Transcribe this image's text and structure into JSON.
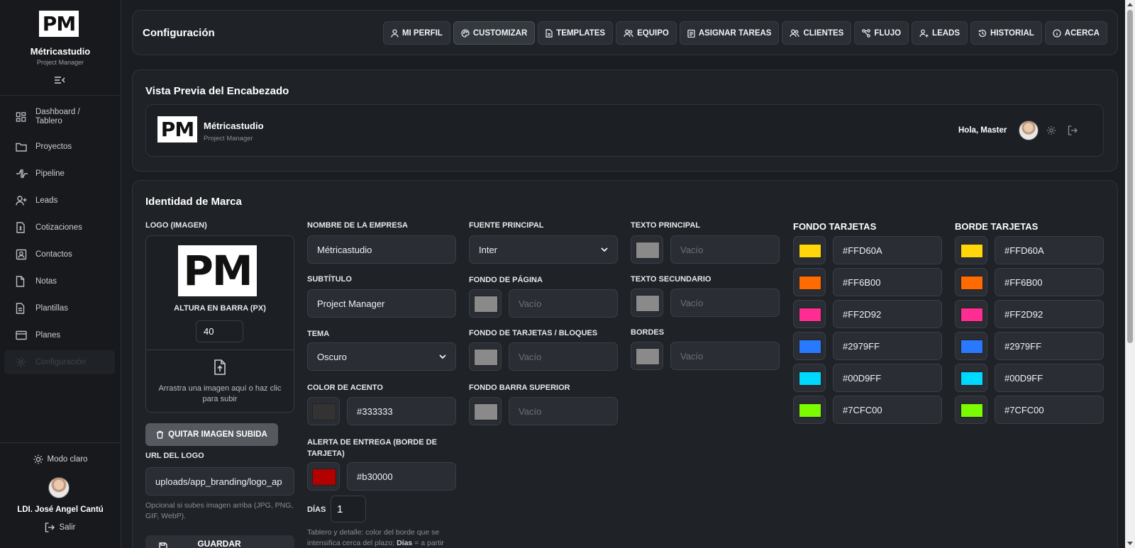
{
  "sidebar": {
    "logo_text": "PM",
    "brand_name": "Métricastudio",
    "brand_sub": "Project Manager",
    "items": [
      {
        "label": "Dashboard / Tablero",
        "icon": "dashboard-icon"
      },
      {
        "label": "Proyectos",
        "icon": "folder-icon"
      },
      {
        "label": "Pipeline",
        "icon": "pipeline-icon"
      },
      {
        "label": "Leads",
        "icon": "user-plus-icon"
      },
      {
        "label": "Cotizaciones",
        "icon": "invoice-icon"
      },
      {
        "label": "Contactos",
        "icon": "contact-icon"
      },
      {
        "label": "Notas",
        "icon": "note-icon"
      },
      {
        "label": "Plantillas",
        "icon": "template-icon"
      },
      {
        "label": "Planes",
        "icon": "card-icon"
      },
      {
        "label": "Configuración",
        "icon": "gear-icon"
      }
    ],
    "mode_label": "Modo claro",
    "user_name": "LDI. José Angel Cantú",
    "logout_label": "Salir"
  },
  "topbar": {
    "title": "Configuración",
    "tabs": [
      {
        "label": "MI PERFIL",
        "icon": "user-icon"
      },
      {
        "label": "CUSTOMIZAR",
        "icon": "palette-icon"
      },
      {
        "label": "TEMPLATES",
        "icon": "file-icon"
      },
      {
        "label": "EQUIPO",
        "icon": "team-icon"
      },
      {
        "label": "ASIGNAR TAREAS",
        "icon": "clipboard-icon"
      },
      {
        "label": "CLIENTES",
        "icon": "clients-icon"
      },
      {
        "label": "FLUJO",
        "icon": "flow-icon"
      },
      {
        "label": "LEADS",
        "icon": "leads-icon"
      },
      {
        "label": "HISTORIAL",
        "icon": "history-icon"
      },
      {
        "label": "ACERCA",
        "icon": "info-icon"
      }
    ]
  },
  "preview": {
    "title": "Vista Previa del Encabezado",
    "logo_text": "PM",
    "brand_name": "Métricastudio",
    "brand_sub": "Project Manager",
    "greeting": "Hola, Master"
  },
  "identity": {
    "title": "Identidad de Marca",
    "logo_label": "LOGO (IMAGEN)",
    "logo_text": "PM",
    "height_label": "ALTURA EN BARRA (PX)",
    "height_value": "40",
    "drop_text": "Arrastra una imagen aquí o haz clic para subir",
    "remove_label": "QUITAR IMAGEN SUBIDA",
    "url_label": "URL DEL LOGO",
    "url_value": "uploads/app_branding/logo_ap",
    "url_hint": "Opcional si subes imagen arriba (JPG, PNG, GIF, WebP).",
    "save_label": "GUARDAR",
    "company_label": "NOMBRE DE LA EMPRESA",
    "company_value": "Métricastudio",
    "subtitle_label": "SUBTÍTULO",
    "subtitle_value": "Project Manager",
    "theme_label": "TEMA",
    "theme_value": "Oscuro",
    "accent_label": "COLOR DE ACENTO",
    "accent_value": "#333333",
    "alert_label": "ALERTA DE ENTREGA (BORDE DE TARJETA)",
    "alert_value": "#b30000",
    "days_label": "DÍAS",
    "days_value": "1",
    "days_hint_pre": "Tablero y detalle: color del borde que se intensifica cerca del plazo; ",
    "days_hint_bold": "Días",
    "days_hint_post": " = a partir",
    "font_label": "FUENTE PRINCIPAL",
    "font_value": "Inter",
    "page_bg_label": "FONDO DE PÁGINA",
    "cards_bg_label": "FONDO DE TARJETAS / BLOQUES",
    "topbar_bg_label": "FONDO BARRA SUPERIOR",
    "text_main_label": "TEXTO PRINCIPAL",
    "text_sec_label": "TEXTO SECUNDARIO",
    "borders_label": "BORDES",
    "empty_placeholder": "Vacío",
    "card_bg_palette_label": "FONDO TARJETAS",
    "card_border_palette_label": "BORDE TARJETAS",
    "palette": [
      "#FFD60A",
      "#FF6B00",
      "#FF2D92",
      "#2979FF",
      "#00D9FF",
      "#7CFC00"
    ]
  },
  "colors": {
    "accent": "#333333",
    "alert": "#b30000",
    "empty_swatch": "#8a8a8a"
  }
}
